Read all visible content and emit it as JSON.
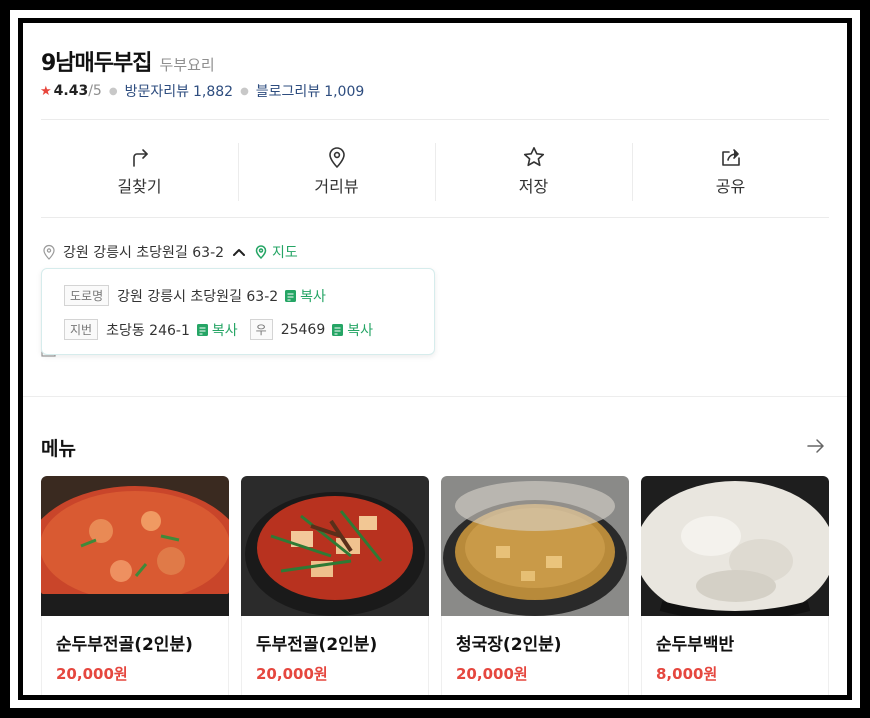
{
  "place": {
    "name": "9남매두부집",
    "category": "두부요리",
    "rating": "4.43",
    "rating_max": "/5",
    "visitor_review_label": "방문자리뷰",
    "visitor_review_count": "1,882",
    "blog_review_label": "블로그리뷰",
    "blog_review_count": "1,009"
  },
  "actions": [
    {
      "label": "길찾기",
      "icon": "directions-icon"
    },
    {
      "label": "거리뷰",
      "icon": "street-view-icon"
    },
    {
      "label": "저장",
      "icon": "star-icon"
    },
    {
      "label": "공유",
      "icon": "share-icon"
    }
  ],
  "address": {
    "summary": "강원 강릉시 초당원길 63-2",
    "map_link": "지도",
    "road_tag": "도로명",
    "road": "강원 강릉시 초당원길 63-2",
    "lot_tag": "지번",
    "lot": "초당동 246-1",
    "postal_tag": "우",
    "postal": "25469",
    "copy_label": "복사"
  },
  "menu": {
    "title": "메뉴",
    "items": [
      {
        "name": "순두부전골(2인분)",
        "price": "20,000원"
      },
      {
        "name": "두부전골(2인분)",
        "price": "20,000원"
      },
      {
        "name": "청국장(2인분)",
        "price": "20,000원"
      },
      {
        "name": "순두부백반",
        "price": "8,000원"
      }
    ]
  },
  "colors": {
    "accent_green": "#25a565",
    "price_red": "#e5473f",
    "review_blue": "#2e4d7f",
    "star_red": "#e8453c"
  }
}
